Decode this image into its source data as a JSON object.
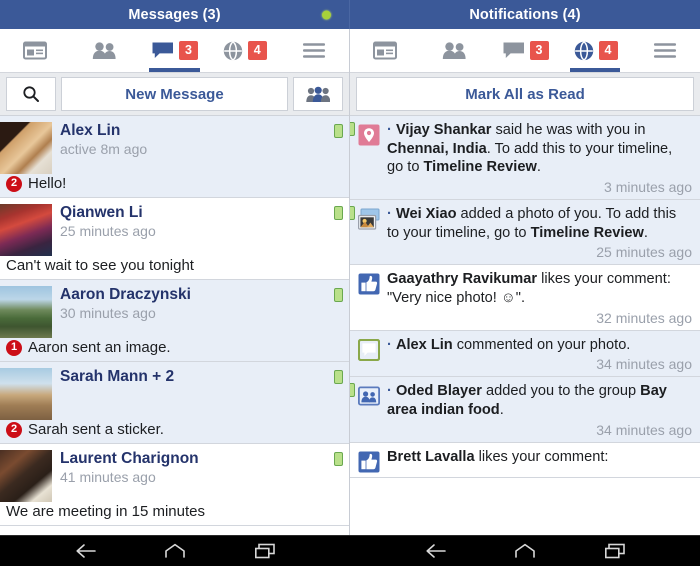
{
  "titlebar": {
    "left_title": "Messages (3)",
    "right_title": "Notifications (4)",
    "status_dot_color": "#a8d13a"
  },
  "theme": {
    "brand_blue": "#3b5998",
    "badge_red": "#e8544c",
    "unread_row": "#e8eef7",
    "read_row": "#ffffff",
    "name_link": "#24336b",
    "muted_text": "#9aa0ab"
  },
  "left_panel": {
    "tabs": [
      {
        "name": "news-feed",
        "icon": "newsfeed-icon",
        "badge": "",
        "active": false
      },
      {
        "name": "friend-requests",
        "icon": "friends-icon",
        "badge": "",
        "active": false
      },
      {
        "name": "messages",
        "icon": "messages-icon",
        "badge": "3",
        "active": true
      },
      {
        "name": "notifications",
        "icon": "globe-icon",
        "badge": "4",
        "active": false
      },
      {
        "name": "more",
        "icon": "hamburger-icon",
        "badge": "",
        "active": false
      }
    ],
    "actions": {
      "search_icon": "search-icon",
      "new_message_label": "New Message",
      "group_icon": "group-people-icon"
    },
    "messages": [
      {
        "name": "Alex Lin",
        "time": "active 8m ago",
        "snippet": "Hello!",
        "unread_count": "2",
        "unread": true,
        "phone_indicator": true
      },
      {
        "name": "Qianwen  Li",
        "time": "25 minutes ago",
        "snippet": "Can't wait to see you tonight",
        "unread_count": "",
        "unread": false,
        "phone_indicator": true
      },
      {
        "name": "Aaron Draczynski",
        "time": "30 minutes ago",
        "snippet": "Aaron sent an image.",
        "unread_count": "1",
        "unread": true,
        "phone_indicator": true
      },
      {
        "name": "Sarah Mann + 2",
        "time": "",
        "snippet": "Sarah sent a sticker.",
        "unread_count": "2",
        "unread": true,
        "phone_indicator": true
      },
      {
        "name": "Laurent Charignon",
        "time": "41 minutes ago",
        "snippet": "We are meeting in 15 minutes",
        "unread_count": "",
        "unread": false,
        "phone_indicator": true
      }
    ]
  },
  "right_panel": {
    "tabs": [
      {
        "name": "news-feed",
        "icon": "newsfeed-icon",
        "badge": "",
        "active": false
      },
      {
        "name": "friend-requests",
        "icon": "friends-icon",
        "badge": "",
        "active": false
      },
      {
        "name": "messages",
        "icon": "messages-icon",
        "badge": "3",
        "active": false
      },
      {
        "name": "notifications",
        "icon": "globe-icon",
        "badge": "4",
        "active": true
      },
      {
        "name": "more",
        "icon": "hamburger-icon",
        "badge": "",
        "active": false
      }
    ],
    "actions": {
      "mark_all_label": "Mark All as Read"
    },
    "notifications": [
      {
        "icon": "location-pin-icon",
        "bullet": true,
        "parts": [
          {
            "text": "Vijay Shankar",
            "bold": true
          },
          {
            "text": " said he was with you in ",
            "bold": false
          },
          {
            "text": "Chennai, India",
            "bold": true
          },
          {
            "text": ". To add this to your timeline, go to ",
            "bold": false
          },
          {
            "text": "Timeline Review",
            "bold": true
          },
          {
            "text": ".",
            "bold": false
          }
        ],
        "time": "3 minutes ago",
        "unread": true,
        "phone_indicator": true
      },
      {
        "icon": "photo-icon",
        "bullet": true,
        "parts": [
          {
            "text": "Wei Xiao",
            "bold": true
          },
          {
            "text": " added a photo of you. To add this to your timeline, go to ",
            "bold": false
          },
          {
            "text": "Timeline Review",
            "bold": true
          },
          {
            "text": ".",
            "bold": false
          }
        ],
        "time": "25 minutes ago",
        "unread": true,
        "phone_indicator": true
      },
      {
        "icon": "thumbs-up-icon",
        "bullet": false,
        "parts": [
          {
            "text": "Gaayathry Ravikumar",
            "bold": true
          },
          {
            "text": " likes your comment: \"Very nice photo! ☺\".",
            "bold": false
          }
        ],
        "time": "32 minutes ago",
        "unread": false,
        "phone_indicator": false
      },
      {
        "icon": "comment-bubble-icon",
        "bullet": true,
        "parts": [
          {
            "text": "Alex Lin",
            "bold": true
          },
          {
            "text": " commented on your photo.",
            "bold": false
          }
        ],
        "time": "34 minutes ago",
        "unread": true,
        "phone_indicator": false
      },
      {
        "icon": "group-icon",
        "bullet": true,
        "parts": [
          {
            "text": "Oded Blayer",
            "bold": true
          },
          {
            "text": " added you to the group ",
            "bold": false
          },
          {
            "text": "Bay area indian food",
            "bold": true
          },
          {
            "text": ".",
            "bold": false
          }
        ],
        "time": "34 minutes ago",
        "unread": true,
        "phone_indicator": true
      },
      {
        "icon": "thumbs-up-icon",
        "bullet": false,
        "parts": [
          {
            "text": "Brett Lavalla",
            "bold": true
          },
          {
            "text": " likes your comment:",
            "bold": false
          }
        ],
        "time": "",
        "unread": false,
        "phone_indicator": false
      }
    ]
  },
  "navbar": {
    "buttons": [
      "back-button",
      "home-button",
      "recents-button"
    ]
  }
}
